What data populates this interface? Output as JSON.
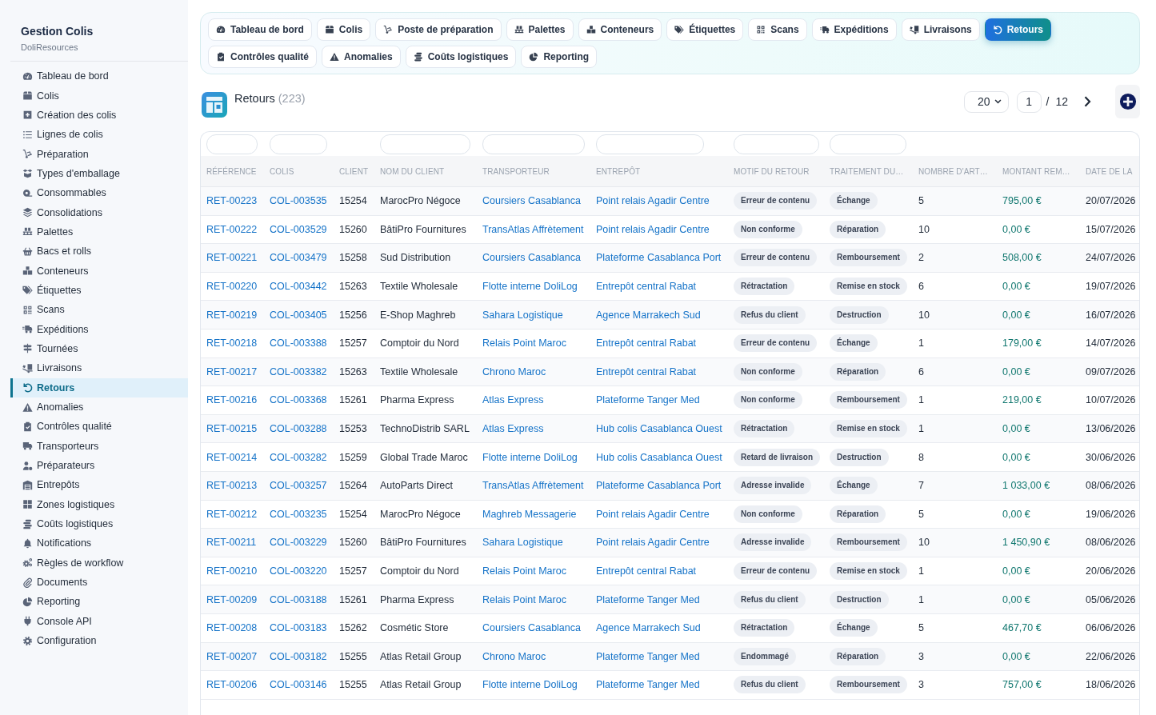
{
  "sidebar": {
    "title": "Gestion Colis",
    "subtitle": "DoliResources",
    "items": [
      {
        "label": "Tableau de bord",
        "selected": false
      },
      {
        "label": "Colis",
        "selected": false
      },
      {
        "label": "Création des colis",
        "selected": false
      },
      {
        "label": "Lignes de colis",
        "selected": false
      },
      {
        "label": "Préparation",
        "selected": false
      },
      {
        "label": "Types d'emballage",
        "selected": false
      },
      {
        "label": "Consommables",
        "selected": false
      },
      {
        "label": "Consolidations",
        "selected": false
      },
      {
        "label": "Palettes",
        "selected": false
      },
      {
        "label": "Bacs et rolls",
        "selected": false
      },
      {
        "label": "Conteneurs",
        "selected": false
      },
      {
        "label": "Étiquettes",
        "selected": false
      },
      {
        "label": "Scans",
        "selected": false
      },
      {
        "label": "Expéditions",
        "selected": false
      },
      {
        "label": "Tournées",
        "selected": false
      },
      {
        "label": "Livraisons",
        "selected": false
      },
      {
        "label": "Retours",
        "selected": true
      },
      {
        "label": "Anomalies",
        "selected": false
      },
      {
        "label": "Contrôles qualité",
        "selected": false
      },
      {
        "label": "Transporteurs",
        "selected": false
      },
      {
        "label": "Préparateurs",
        "selected": false
      },
      {
        "label": "Entrepôts",
        "selected": false
      },
      {
        "label": "Zones logistiques",
        "selected": false
      },
      {
        "label": "Coûts logistiques",
        "selected": false
      },
      {
        "label": "Notifications",
        "selected": false
      },
      {
        "label": "Règles de workflow",
        "selected": false
      },
      {
        "label": "Documents",
        "selected": false
      },
      {
        "label": "Reporting",
        "selected": false
      },
      {
        "label": "Console API",
        "selected": false
      },
      {
        "label": "Configuration",
        "selected": false
      }
    ]
  },
  "tabs": [
    {
      "label": "Tableau de bord",
      "selected": false
    },
    {
      "label": "Colis",
      "selected": false
    },
    {
      "label": "Poste de préparation",
      "selected": false
    },
    {
      "label": "Palettes",
      "selected": false
    },
    {
      "label": "Conteneurs",
      "selected": false
    },
    {
      "label": "Étiquettes",
      "selected": false
    },
    {
      "label": "Scans",
      "selected": false
    },
    {
      "label": "Expéditions",
      "selected": false
    },
    {
      "label": "Livraisons",
      "selected": false
    },
    {
      "label": "Retours",
      "selected": true
    },
    {
      "label": "Contrôles qualité",
      "selected": false
    },
    {
      "label": "Anomalies",
      "selected": false
    },
    {
      "label": "Coûts logistiques",
      "selected": false
    },
    {
      "label": "Reporting",
      "selected": false
    }
  ],
  "page": {
    "title": "Retours",
    "count": "(223)"
  },
  "pagination": {
    "per_page": "20",
    "page": "1",
    "separator": "/",
    "total_pages": "12"
  },
  "table": {
    "columns": [
      {
        "label": "RÉFÉRENCE",
        "kind": "link",
        "filter": true
      },
      {
        "label": "COLIS",
        "kind": "link",
        "filter": true
      },
      {
        "label": "CLIENT",
        "kind": "text",
        "filter": false
      },
      {
        "label": "NOM DU CLIENT",
        "kind": "text",
        "filter": true
      },
      {
        "label": "TRANSPORTEUR",
        "kind": "link",
        "filter": true
      },
      {
        "label": "ENTREPÔT",
        "kind": "link",
        "filter": true
      },
      {
        "label": "MOTIF DU RETOUR",
        "kind": "badge",
        "filter": true
      },
      {
        "label": "TRAITEMENT DU…",
        "kind": "badge",
        "filter": true
      },
      {
        "label": "NOMBRE D'ART…",
        "kind": "text",
        "filter": false
      },
      {
        "label": "MONTANT REM…",
        "kind": "amount",
        "filter": false
      },
      {
        "label": "DATE DE LA",
        "kind": "text",
        "filter": false
      }
    ],
    "rows": [
      [
        "RET-00223",
        "COL-003535",
        "15254",
        "MarocPro Négoce",
        "Coursiers Casablanca",
        "Point relais Agadir Centre",
        "Erreur de contenu",
        "Échange",
        "5",
        "795,00 €",
        "20/07/2026"
      ],
      [
        "RET-00222",
        "COL-003529",
        "15260",
        "BâtiPro Fournitures",
        "TransAtlas Affrètement",
        "Point relais Agadir Centre",
        "Non conforme",
        "Réparation",
        "10",
        "0,00 €",
        "15/07/2026"
      ],
      [
        "RET-00221",
        "COL-003479",
        "15258",
        "Sud Distribution",
        "Coursiers Casablanca",
        "Plateforme Casablanca Port",
        "Erreur de contenu",
        "Remboursement",
        "2",
        "508,00 €",
        "24/07/2026"
      ],
      [
        "RET-00220",
        "COL-003442",
        "15263",
        "Textile Wholesale",
        "Flotte interne DoliLog",
        "Entrepôt central Rabat",
        "Rétractation",
        "Remise en stock",
        "6",
        "0,00 €",
        "19/07/2026"
      ],
      [
        "RET-00219",
        "COL-003405",
        "15256",
        "E-Shop Maghreb",
        "Sahara Logistique",
        "Agence Marrakech Sud",
        "Refus du client",
        "Destruction",
        "10",
        "0,00 €",
        "16/07/2026"
      ],
      [
        "RET-00218",
        "COL-003388",
        "15257",
        "Comptoir du Nord",
        "Relais Point Maroc",
        "Entrepôt central Rabat",
        "Erreur de contenu",
        "Échange",
        "1",
        "179,00 €",
        "14/07/2026"
      ],
      [
        "RET-00217",
        "COL-003382",
        "15263",
        "Textile Wholesale",
        "Chrono Maroc",
        "Entrepôt central Rabat",
        "Non conforme",
        "Réparation",
        "6",
        "0,00 €",
        "09/07/2026"
      ],
      [
        "RET-00216",
        "COL-003368",
        "15261",
        "Pharma Express",
        "Atlas Express",
        "Plateforme Tanger Med",
        "Non conforme",
        "Remboursement",
        "1",
        "219,00 €",
        "10/07/2026"
      ],
      [
        "RET-00215",
        "COL-003288",
        "15253",
        "TechnoDistrib SARL",
        "Atlas Express",
        "Hub colis Casablanca Ouest",
        "Rétractation",
        "Remise en stock",
        "1",
        "0,00 €",
        "13/06/2026"
      ],
      [
        "RET-00214",
        "COL-003282",
        "15259",
        "Global Trade Maroc",
        "Flotte interne DoliLog",
        "Hub colis Casablanca Ouest",
        "Retard de livraison",
        "Destruction",
        "8",
        "0,00 €",
        "30/06/2026"
      ],
      [
        "RET-00213",
        "COL-003257",
        "15264",
        "AutoParts Direct",
        "TransAtlas Affrètement",
        "Plateforme Casablanca Port",
        "Adresse invalide",
        "Échange",
        "7",
        "1 033,00 €",
        "08/06/2026"
      ],
      [
        "RET-00212",
        "COL-003235",
        "15254",
        "MarocPro Négoce",
        "Maghreb Messagerie",
        "Point relais Agadir Centre",
        "Non conforme",
        "Réparation",
        "5",
        "0,00 €",
        "19/06/2026"
      ],
      [
        "RET-00211",
        "COL-003229",
        "15260",
        "BâtiPro Fournitures",
        "Sahara Logistique",
        "Point relais Agadir Centre",
        "Adresse invalide",
        "Remboursement",
        "10",
        "1 450,90 €",
        "08/06/2026"
      ],
      [
        "RET-00210",
        "COL-003220",
        "15257",
        "Comptoir du Nord",
        "Relais Point Maroc",
        "Entrepôt central Rabat",
        "Erreur de contenu",
        "Remise en stock",
        "1",
        "0,00 €",
        "20/06/2026"
      ],
      [
        "RET-00209",
        "COL-003188",
        "15261",
        "Pharma Express",
        "Relais Point Maroc",
        "Plateforme Tanger Med",
        "Refus du client",
        "Destruction",
        "1",
        "0,00 €",
        "05/06/2026"
      ],
      [
        "RET-00208",
        "COL-003183",
        "15262",
        "Cosmétic Store",
        "Coursiers Casablanca",
        "Agence Marrakech Sud",
        "Rétractation",
        "Échange",
        "5",
        "467,70 €",
        "06/06/2026"
      ],
      [
        "RET-00207",
        "COL-003182",
        "15255",
        "Atlas Retail Group",
        "Chrono Maroc",
        "Plateforme Tanger Med",
        "Endommagé",
        "Réparation",
        "3",
        "0,00 €",
        "22/06/2026"
      ],
      [
        "RET-00206",
        "COL-003146",
        "15255",
        "Atlas Retail Group",
        "Flotte interne DoliLog",
        "Plateforme Tanger Med",
        "Refus du client",
        "Remboursement",
        "3",
        "757,00 €",
        "18/06/2026"
      ]
    ]
  }
}
